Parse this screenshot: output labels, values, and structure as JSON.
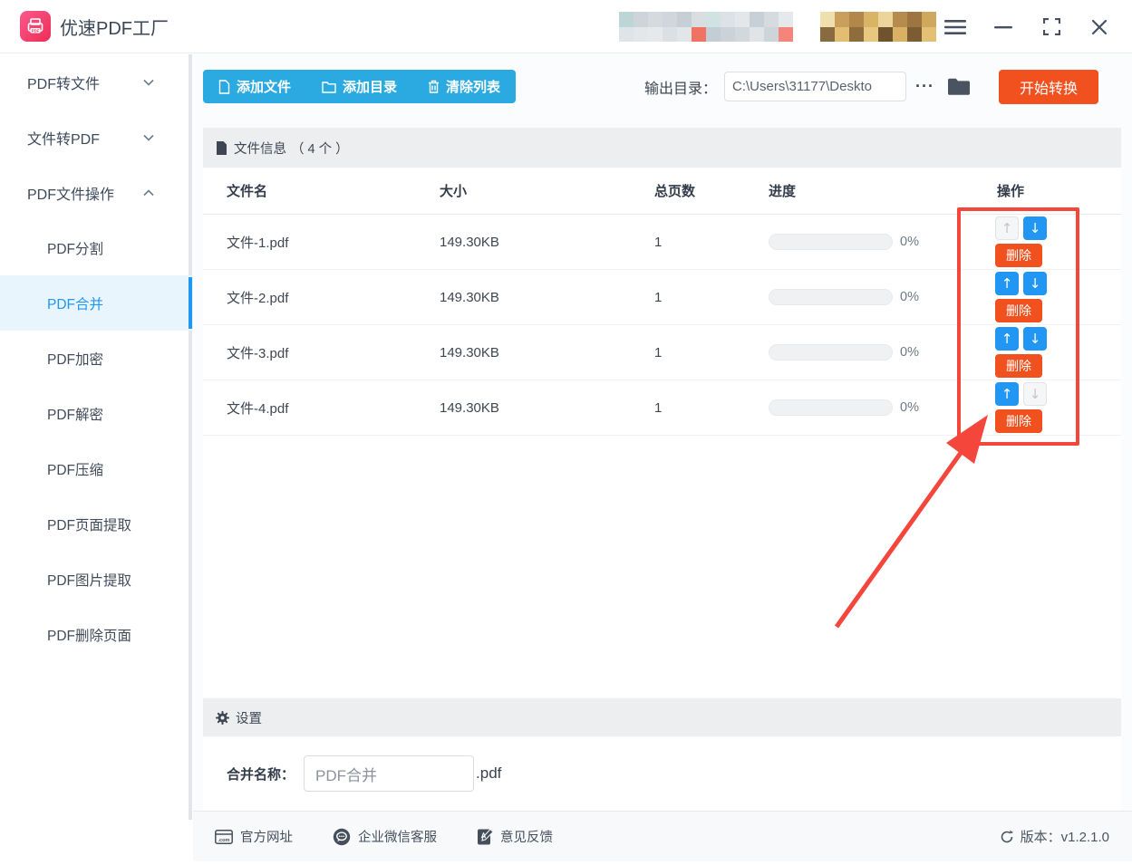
{
  "app": {
    "title": "优速PDF工厂"
  },
  "titlebar": {
    "controls": [
      "menu",
      "minimize",
      "maximize",
      "close"
    ]
  },
  "redacted": {
    "block1": {
      "colors": [
        "#bcd6d5",
        "#dfe4e9",
        "#cdd5da",
        "#e3e7ea",
        "#d4dade",
        "#e6e9ec",
        "#d0d7dc",
        "#dbe0e4",
        "#c6cfd5",
        "#e2e6e9",
        "#d8dee2",
        "#ef7262",
        "#cfe3e2",
        "#c3ced4",
        "#dde2e6",
        "#cbd3d8",
        "#e4e7ea",
        "#d2d9dd",
        "#c7d0d6",
        "#e0e4e7",
        "#d5dbdf",
        "#cdd5da",
        "#e6e9eb",
        "#f5857a"
      ]
    },
    "block2": {
      "colors": [
        "#f0dfae",
        "#8a6a3f",
        "#c9a05b",
        "#e3bd72",
        "#b28749",
        "#8f6c3c",
        "#d9b366",
        "#e8c87e",
        "#ecd49a",
        "#6f522e",
        "#b68c4e",
        "#d9b164",
        "#9c7540",
        "#7c5c33",
        "#cfa85e",
        "#e3c073"
      ]
    }
  },
  "sidebar": {
    "items": [
      {
        "label": "PDF转文件",
        "type": "group",
        "chevron": "down"
      },
      {
        "label": "文件转PDF",
        "type": "group",
        "chevron": "down"
      },
      {
        "label": "PDF文件操作",
        "type": "group",
        "chevron": "up"
      },
      {
        "label": "PDF分割",
        "type": "sub"
      },
      {
        "label": "PDF合并",
        "type": "sub",
        "selected": true
      },
      {
        "label": "PDF加密",
        "type": "sub"
      },
      {
        "label": "PDF解密",
        "type": "sub"
      },
      {
        "label": "PDF压缩",
        "type": "sub"
      },
      {
        "label": "PDF页面提取",
        "type": "sub"
      },
      {
        "label": "PDF图片提取",
        "type": "sub"
      },
      {
        "label": "PDF删除页面",
        "type": "sub"
      }
    ]
  },
  "toolbar": {
    "add_file": "添加文件",
    "add_dir": "添加目录",
    "clear_list": "清除列表",
    "output_label": "输出目录：",
    "output_value": "C:\\Users\\31177\\Deskto",
    "more_label": "···",
    "start_label": "开始转换"
  },
  "file_panel": {
    "title": "文件信息",
    "count_text": "（ 4 个 ）"
  },
  "table": {
    "columns": [
      "文件名",
      "大小",
      "总页数",
      "进度",
      "操作"
    ],
    "up_glyph": "↑",
    "down_glyph": "↓",
    "delete_label": "删除",
    "rows": [
      {
        "name": "文件-1.pdf",
        "size": "149.30KB",
        "pages": "1",
        "progress": "0%",
        "up_enabled": false,
        "down_enabled": true
      },
      {
        "name": "文件-2.pdf",
        "size": "149.30KB",
        "pages": "1",
        "progress": "0%",
        "up_enabled": true,
        "down_enabled": true
      },
      {
        "name": "文件-3.pdf",
        "size": "149.30KB",
        "pages": "1",
        "progress": "0%",
        "up_enabled": true,
        "down_enabled": true
      },
      {
        "name": "文件-4.pdf",
        "size": "149.30KB",
        "pages": "1",
        "progress": "0%",
        "up_enabled": true,
        "down_enabled": false
      }
    ]
  },
  "settings": {
    "title": "设置",
    "merge_label": "合并名称：",
    "merge_value": "PDF合并",
    "ext": ".pdf"
  },
  "footer": {
    "links": [
      {
        "label": "官方网址",
        "icon": "website-icon"
      },
      {
        "label": "企业微信客服",
        "icon": "wechat-service-icon"
      },
      {
        "label": "意见反馈",
        "icon": "feedback-icon"
      }
    ],
    "version": "版本：v1.2.1.0"
  },
  "colors": {
    "toolbar_blue": "#2ba9e1",
    "action_blue": "#2196f3",
    "danger_orange": "#f1511e",
    "annotation_red": "#f5463c",
    "selected_bg": "#e9f5fd"
  }
}
